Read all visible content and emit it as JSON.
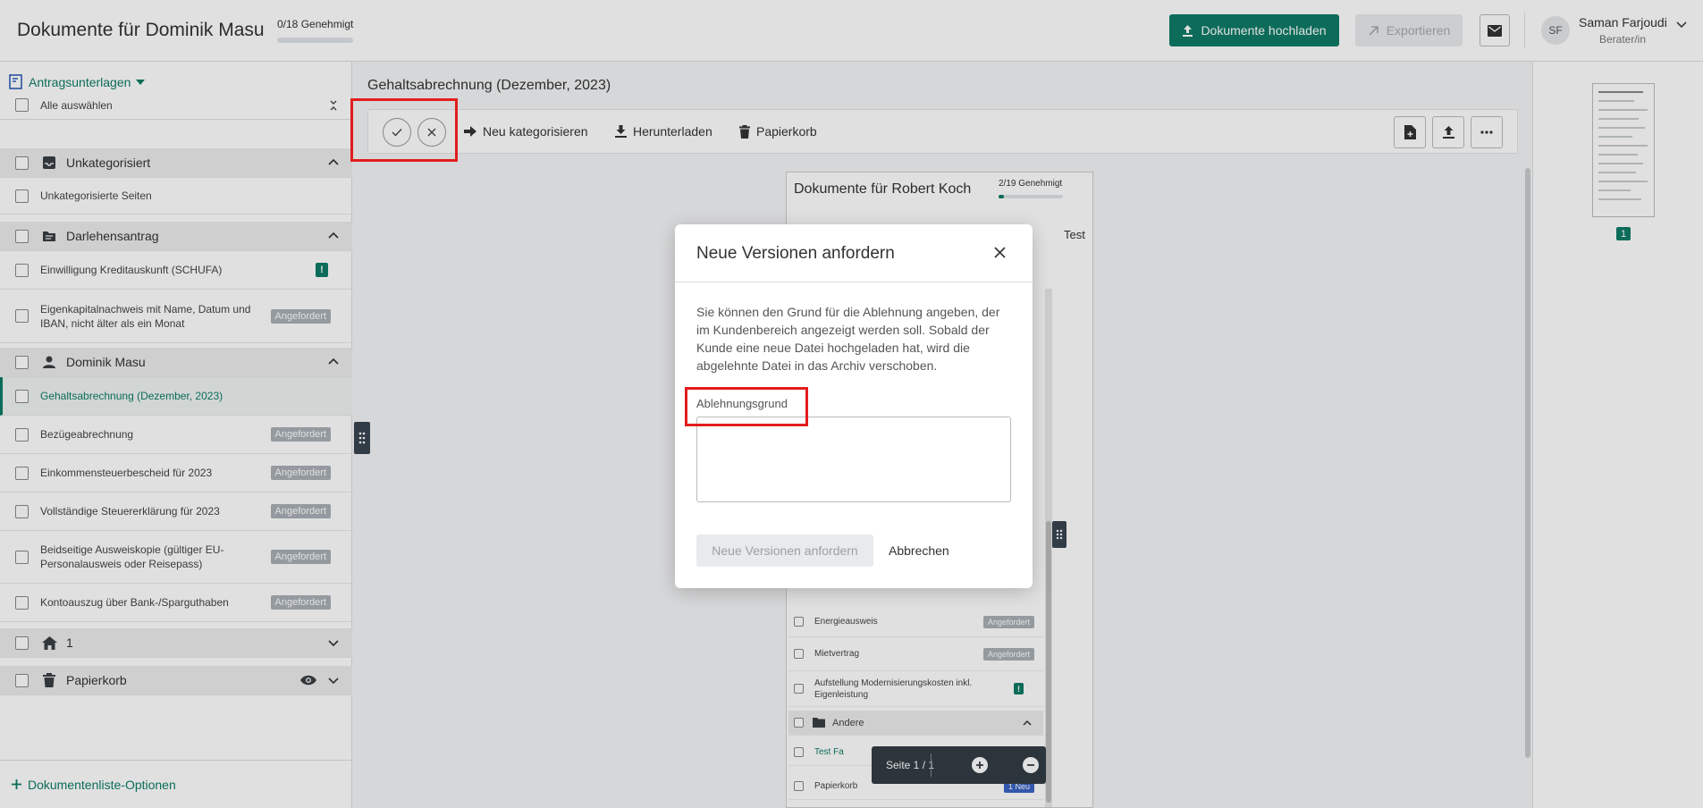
{
  "header": {
    "title": "Dokumente für Dominik Masu",
    "approved": "0/18 Genehmigt",
    "upload_label": "Dokumente hochladen",
    "export_label": "Exportieren",
    "user_initials": "SF",
    "user_name": "Saman Farjoudi",
    "user_role": "Berater/in"
  },
  "sidebar": {
    "section_label": "Antragsunterlagen",
    "select_all": "Alle auswählen",
    "groups": [
      {
        "label": "Unkategorisiert"
      },
      {
        "label": "Darlehensantrag"
      },
      {
        "label": "Dominik Masu"
      },
      {
        "label": "1"
      },
      {
        "label": "Papierkorb"
      }
    ],
    "items": [
      {
        "label": "Unkategorisierte Seiten"
      },
      {
        "label": "Einwilligung Kreditauskunft (SCHUFA)",
        "badge": "!"
      },
      {
        "label": "Eigenkapitalnachweis mit Name, Datum und IBAN, nicht älter als ein Monat",
        "tag": "Angefordert"
      },
      {
        "label": "Gehaltsabrechnung (Dezember, 2023)"
      },
      {
        "label": "Bezügeabrechnung",
        "tag": "Angefordert"
      },
      {
        "label": "Einkommensteuerbescheid für 2023",
        "tag": "Angefordert"
      },
      {
        "label": "Vollständige Steuererklärung für 2023",
        "tag": "Angefordert"
      },
      {
        "label": "Beidseitige Ausweiskopie (gültiger EU-Personalausweis oder Reisepass)",
        "tag": "Angefordert"
      },
      {
        "label": "Kontoauszug über Bank-/Sparguthaben",
        "tag": "Angefordert"
      }
    ],
    "footer_label": "Dokumentenliste-Optionen"
  },
  "main": {
    "title": "Gehaltsabrechnung (Dezember, 2023)",
    "recategorize": "Neu kategorisieren",
    "download": "Herunterladen",
    "trash": "Papierkorb"
  },
  "preview": {
    "title": "Dokumente für Robert Koch",
    "approved": "2/19 Genehmigt",
    "side_tab": "Test",
    "rows": [
      {
        "label": "Energieausweis",
        "tag": "Angefordert"
      },
      {
        "label": "Mietvertrag",
        "tag": "Angefordert"
      },
      {
        "label": "Aufstellung Modernisierungskosten inkl. Eigenleistung",
        "badge": "!"
      },
      {
        "label": "Andere"
      },
      {
        "label": "Test Fa"
      },
      {
        "label": "Papierkorb",
        "tag": "1 Neu"
      }
    ]
  },
  "pager": {
    "label": "Seite 1 / 1"
  },
  "thumbnail": {
    "page_number": "1"
  },
  "modal": {
    "title": "Neue Versionen anfordern",
    "text": "Sie können den Grund für die Ablehnung angeben, der im Kundenbereich angezeigt werden soll. Sobald der Kunde eine neue Datei hochgeladen hat, wird die abgelehnte Datei in das Archiv verschoben.",
    "field_label": "Ablehnungsgrund",
    "field_value": "",
    "submit_label": "Neue Versionen anfordern",
    "cancel_label": "Abbrechen"
  },
  "colors": {
    "accent": "#0e7c66",
    "highlight": "#e21d1d",
    "tag": "#a9b0b6"
  }
}
